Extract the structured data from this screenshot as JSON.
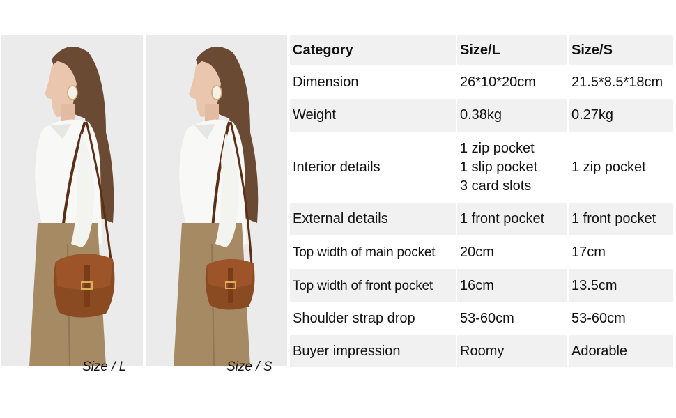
{
  "photos": [
    {
      "caption": "Size / L"
    },
    {
      "caption": "Size / S"
    }
  ],
  "table": {
    "headers": [
      "Category",
      "Size/L",
      "Size/S"
    ],
    "rows": [
      {
        "category": "Dimension",
        "size_l": [
          "26*10*20cm"
        ],
        "size_s": [
          "21.5*8.5*18cm"
        ]
      },
      {
        "category": "Weight",
        "size_l": [
          "0.38kg"
        ],
        "size_s": [
          "0.27kg"
        ]
      },
      {
        "category": "Interior details",
        "size_l": [
          "1 zip pocket",
          "1 slip pocket",
          "3 card slots"
        ],
        "size_s": [
          "1 zip pocket"
        ]
      },
      {
        "category": "External details",
        "size_l": [
          "1 front pocket"
        ],
        "size_s": [
          "1 front pocket"
        ]
      },
      {
        "category": "Top width of main pocket",
        "size_l": [
          "20cm"
        ],
        "size_s": [
          "17cm"
        ]
      },
      {
        "category": "Top width of front pocket",
        "size_l": [
          "16cm"
        ],
        "size_s": [
          "13.5cm"
        ]
      },
      {
        "category": "Shoulder strap drop",
        "size_l": [
          "53-60cm"
        ],
        "size_s": [
          "53-60cm"
        ]
      },
      {
        "category": "Buyer impression",
        "size_l": [
          "Roomy"
        ],
        "size_s": [
          "Adorable"
        ]
      }
    ]
  }
}
